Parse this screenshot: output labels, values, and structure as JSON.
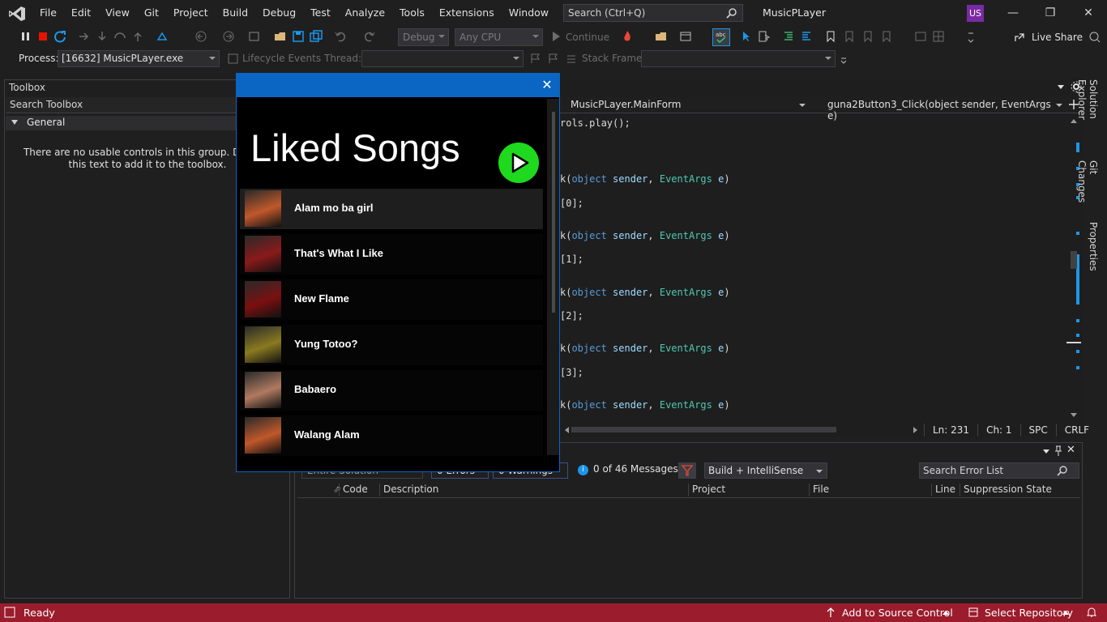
{
  "ide": {
    "window_title": "MusicPLayer",
    "user_initials": "US",
    "menu": [
      "File",
      "Edit",
      "View",
      "Git",
      "Project",
      "Build",
      "Debug",
      "Test",
      "Analyze",
      "Tools",
      "Extensions",
      "Window",
      "Help"
    ],
    "search_placeholder": "Search (Ctrl+Q)",
    "toolbar": {
      "config": "Debug",
      "platform": "Any CPU",
      "continue": "Continue",
      "live_share": "Live Share"
    },
    "location_bar": {
      "process_label": "Process:",
      "process_value": "[16632] MusicPLayer.exe",
      "lifecycle": "Lifecycle Events",
      "thread_label": "Thread:",
      "stack_label": "Stack Frame:"
    }
  },
  "toolbox": {
    "title": "Toolbox",
    "search": "Search Toolbox",
    "group": "General",
    "empty_line1": "There are no usable controls in this group. Drag an",
    "empty_line2": "this text to add it to the toolbox."
  },
  "editor": {
    "class_combo": "MusicPLayer.MainForm",
    "method_combo": "guna2Button3_Click(object sender, EventArgs e)",
    "lines": {
      "l1": "rols.play();",
      "k": "k(",
      "kw_object": "object",
      "p_sender": "sender",
      "ty_eventargs": "EventArgs",
      "p_e": "e",
      "idx0": "[0];",
      "idx1": "[1];",
      "idx2": "[2];",
      "idx3": "[3];"
    },
    "status": {
      "ln": "Ln: 231",
      "ch": "Ch: 1",
      "spc": "SPC",
      "crlf": "CRLF"
    }
  },
  "error_list": {
    "scope": "Entire Solution",
    "errors": "0 Errors",
    "warnings": "0 Warnings",
    "messages": "0 of 46 Messages",
    "build_filter": "Build + IntelliSense",
    "search": "Search Error List",
    "columns": [
      "Code",
      "Description",
      "Project",
      "File",
      "Line",
      "Suppression State"
    ]
  },
  "dock_tabs": [
    "Solution Explorer",
    "Git Changes",
    "Properties"
  ],
  "statusbar": {
    "ready": "Ready",
    "source_control": "Add to Source Control",
    "repository": "Select Repository"
  },
  "music_app": {
    "heading": "Liked Songs",
    "songs": [
      {
        "title": "Alam mo ba girl",
        "thumb_color": "#c0582a"
      },
      {
        "title": "That's What I Like",
        "thumb_color": "#8a1a1a"
      },
      {
        "title": "New Flame",
        "thumb_color": "#7a1010"
      },
      {
        "title": "Yung Totoo?",
        "thumb_color": "#8a7a20"
      },
      {
        "title": "Babaero",
        "thumb_color": "#b07a60"
      },
      {
        "title": "Walang Alam",
        "thumb_color": "#c0582a"
      }
    ],
    "accent": "#1ed91e",
    "titlebar_color": "#0a66c2"
  }
}
